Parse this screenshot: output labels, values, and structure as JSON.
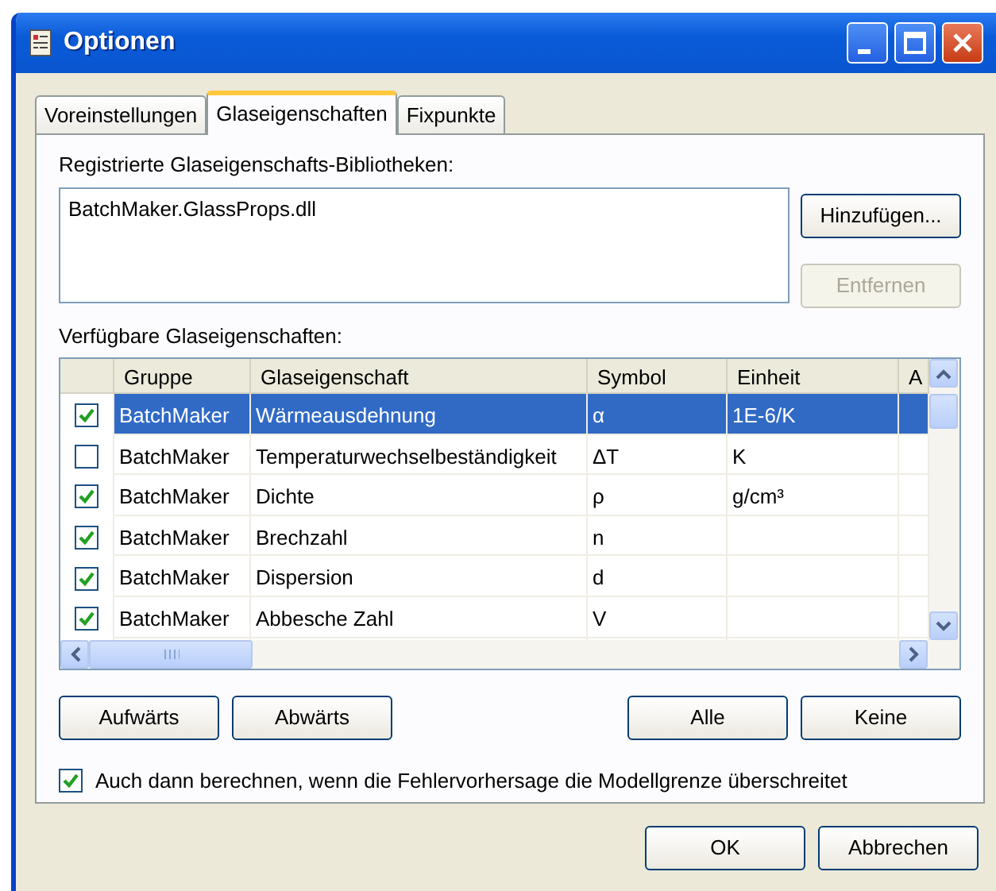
{
  "window": {
    "title": "Optionen"
  },
  "tabs": [
    {
      "label": "Voreinstellungen",
      "selected": false
    },
    {
      "label": "Glaseigenschaften",
      "selected": true
    },
    {
      "label": "Fixpunkte",
      "selected": false
    }
  ],
  "libraries": {
    "label": "Registrierte Glaseigenschafts-Bibliotheken:",
    "items": [
      "BatchMaker.GlassProps.dll"
    ],
    "buttons": [
      {
        "label": "Hinzufügen...",
        "disabled": false
      },
      {
        "label": "Entfernen",
        "disabled": true
      }
    ]
  },
  "properties": {
    "label": "Verfügbare Glaseigenschaften:",
    "columns": [
      "Gruppe",
      "Glaseigenschaft",
      "Symbol",
      "Einheit",
      "A"
    ],
    "rows": [
      {
        "checked": true,
        "selected": true,
        "group": "BatchMaker",
        "property": "Wärmeausdehnung",
        "symbol": "α",
        "unit": "1E-6/K"
      },
      {
        "checked": false,
        "selected": false,
        "group": "BatchMaker",
        "property": "Temperaturwechselbeständigkeit",
        "symbol": "ΔT",
        "unit": "K"
      },
      {
        "checked": true,
        "selected": false,
        "group": "BatchMaker",
        "property": "Dichte",
        "symbol": "ρ",
        "unit": "g/cm³"
      },
      {
        "checked": true,
        "selected": false,
        "group": "BatchMaker",
        "property": "Brechzahl",
        "symbol": "n"
      },
      {
        "checked": true,
        "selected": false,
        "group": "BatchMaker",
        "property": "Dispersion",
        "symbol": "d"
      },
      {
        "checked": true,
        "selected": false,
        "group": "BatchMaker",
        "property": "Abbesche Zahl",
        "symbol": "V"
      }
    ]
  },
  "move_buttons": [
    "Aufwärts",
    "Abwärts"
  ],
  "select_buttons": [
    "Alle",
    "Keine"
  ],
  "option": {
    "label": "Auch dann berechnen, wenn die Fehlervorhersage die Modellgrenze überschreitet",
    "checked": true
  },
  "dialog_buttons": [
    "OK",
    "Abbrechen"
  ]
}
